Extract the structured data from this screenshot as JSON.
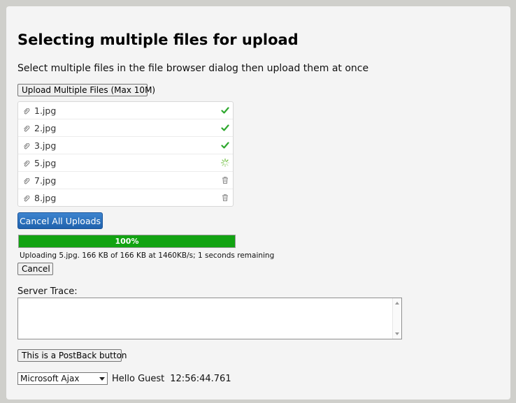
{
  "page": {
    "title": "Selecting multiple files for upload",
    "subtitle": "Select multiple files in the file browser dialog then upload them at once"
  },
  "upload_button_label": "Upload Multiple Files (Max 10M)",
  "files": [
    {
      "name": "1.jpg",
      "status": "done",
      "status_icon": "checkmark-icon"
    },
    {
      "name": "2.jpg",
      "status": "done",
      "status_icon": "checkmark-icon"
    },
    {
      "name": "3.jpg",
      "status": "done",
      "status_icon": "checkmark-icon"
    },
    {
      "name": "5.jpg",
      "status": "uploading",
      "status_icon": "spinner-icon"
    },
    {
      "name": "7.jpg",
      "status": "queued",
      "status_icon": "trash-icon"
    },
    {
      "name": "8.jpg",
      "status": "queued",
      "status_icon": "trash-icon"
    }
  ],
  "cancel_all_label": "Cancel All Uploads",
  "progress": {
    "percent": 100,
    "label": "100%",
    "status_text": "Uploading 5.jpg. 166 KB of 166 KB at 1460KB/s; 1 seconds remaining"
  },
  "cancel_label": "Cancel",
  "trace_label": "Server Trace:",
  "trace_value": "",
  "postback_label": "This is a PostBack button",
  "ajax_select": {
    "selected": "Microsoft Ajax"
  },
  "greeting": "Hello Guest",
  "clock": "12:56:44.761",
  "colors": {
    "progress_fill": "#12a312",
    "primary_button": "#2a6fbf",
    "check": "#2ea82e",
    "spinner": "#6fbf3f"
  }
}
